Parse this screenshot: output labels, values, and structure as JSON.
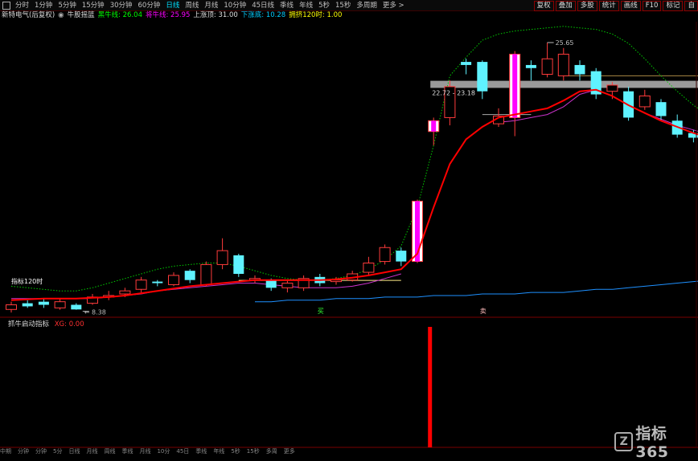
{
  "toolbar": {
    "periods": [
      "分时",
      "1分钟",
      "5分钟",
      "15分钟",
      "30分钟",
      "60分钟",
      "日线",
      "周线",
      "月线",
      "10分钟",
      "45日线",
      "季线",
      "年线",
      "5秒",
      "15秒",
      "多周期",
      "更多 >"
    ],
    "active": "日线",
    "right_buttons": [
      "复权",
      "叠加",
      "多股",
      "统计",
      "画线",
      "F10",
      "标记",
      "自"
    ]
  },
  "legend": {
    "stock": "新特电气(后复权)",
    "formula": "牛股摇篮",
    "items": [
      {
        "label": "黑牛线: 26.04",
        "color": "#00ff00"
      },
      {
        "label": "将牛线: 25.95",
        "color": "#ff00ff"
      },
      {
        "label": "上涨顶: 31.00",
        "color": "#dddddd"
      },
      {
        "label": "下涨底: 10.28",
        "color": "#00ccff"
      },
      {
        "label": "拥挤120时: 1.00",
        "color": "#ffff00"
      }
    ]
  },
  "annotations": {
    "high": "25.65",
    "low": "8.38",
    "band": "22.72 - 23.18",
    "left_label": "指标120时",
    "buy": "买",
    "sell": "卖"
  },
  "indicator": {
    "name": "抓牛启动指标",
    "value": "XG: 0.00"
  },
  "colors": {
    "up": "#ff3b3b",
    "down": "#5ff2ff",
    "ma": "#ff0000",
    "ma2": "#cc33cc",
    "upper": "#00cc00",
    "lower": "#1e90ff",
    "signal": "#ff0000"
  },
  "bottom": [
    "中期",
    "分钟",
    "分钟",
    "5分",
    "日线",
    "月线",
    "周线",
    "季线",
    "月线",
    "10分",
    "45日",
    "季线",
    "年线",
    "5秒",
    "15秒",
    "多周",
    "更多"
  ],
  "watermark": "指标365",
  "chart_data": {
    "type": "candlestick",
    "price_range": [
      8.0,
      27.0
    ],
    "candles": [
      [
        8.4,
        8.7,
        8.2,
        8.9
      ],
      [
        8.8,
        8.6,
        8.5,
        9.0
      ],
      [
        8.9,
        8.7,
        8.5,
        9.1
      ],
      [
        8.5,
        8.9,
        8.38,
        9.1
      ],
      [
        8.7,
        8.4,
        8.38,
        8.8
      ],
      [
        8.8,
        9.2,
        8.7,
        9.4
      ],
      [
        9.2,
        9.3,
        9.0,
        9.6
      ],
      [
        9.4,
        9.6,
        9.2,
        9.8
      ],
      [
        9.7,
        10.3,
        9.5,
        10.5
      ],
      [
        10.2,
        10.1,
        9.9,
        10.3
      ],
      [
        10.0,
        10.6,
        9.9,
        10.8
      ],
      [
        10.9,
        10.3,
        10.1,
        11.0
      ],
      [
        10.0,
        11.3,
        9.9,
        11.5
      ],
      [
        11.3,
        12.2,
        11.0,
        13.0
      ],
      [
        11.9,
        10.7,
        10.5,
        12.0
      ],
      [
        10.3,
        10.4,
        10.1,
        10.6
      ],
      [
        10.3,
        9.8,
        9.6,
        10.4
      ],
      [
        9.8,
        10.1,
        9.5,
        10.3
      ],
      [
        9.8,
        10.4,
        9.6,
        10.6
      ],
      [
        10.5,
        10.1,
        9.9,
        10.7
      ],
      [
        10.2,
        10.3,
        10.0,
        10.5
      ],
      [
        10.3,
        10.7,
        10.2,
        10.9
      ],
      [
        10.8,
        11.4,
        10.6,
        11.8
      ],
      [
        11.5,
        12.4,
        11.3,
        12.6
      ],
      [
        12.2,
        11.5,
        11.2,
        12.4
      ],
      [
        11.5,
        15.4,
        11.4,
        15.5
      ],
      [
        19.9,
        20.6,
        19.0,
        20.8
      ],
      [
        20.8,
        22.8,
        20.3,
        23.2
      ],
      [
        24.4,
        24.2,
        23.6,
        24.6
      ],
      [
        24.4,
        22.5,
        22.0,
        24.5
      ],
      [
        20.4,
        20.9,
        20.2,
        21.4
      ],
      [
        20.8,
        24.9,
        19.6,
        25.1
      ],
      [
        24.2,
        24.0,
        23.2,
        24.5
      ],
      [
        23.6,
        24.6,
        23.4,
        25.65
      ],
      [
        23.5,
        24.9,
        23.2,
        25.3
      ],
      [
        24.2,
        23.6,
        23.2,
        24.5
      ],
      [
        23.8,
        22.3,
        22.0,
        24.0
      ],
      [
        22.5,
        22.9,
        22.0,
        23.1
      ],
      [
        22.5,
        20.8,
        20.6,
        22.8
      ],
      [
        21.5,
        22.2,
        21.3,
        22.6
      ],
      [
        21.8,
        20.9,
        20.6,
        22.0
      ],
      [
        20.6,
        19.7,
        19.5,
        21.0
      ],
      [
        19.8,
        19.5,
        19.2,
        20.0
      ],
      [
        19.5,
        19.8,
        19.2,
        20.1
      ],
      [
        19.6,
        18.9,
        18.5,
        19.9
      ],
      [
        18.6,
        19.5,
        18.5,
        19.6
      ],
      [
        19.1,
        20.0,
        19.0,
        20.4
      ]
    ],
    "ma_line": [
      9.0,
      9.05,
      9.1,
      9.1,
      9.1,
      9.15,
      9.2,
      9.3,
      9.45,
      9.6,
      9.75,
      9.9,
      10.0,
      10.1,
      10.2,
      10.3,
      10.3,
      10.3,
      10.3,
      10.3,
      10.35,
      10.45,
      10.6,
      10.8,
      11.0,
      12.0,
      15.0,
      17.8,
      19.4,
      20.2,
      20.8,
      21.0,
      21.2,
      21.4,
      21.9,
      22.5,
      22.6,
      22.2,
      21.6,
      21.1,
      20.6,
      20.2,
      19.8,
      19.5,
      19.3,
      19.0,
      18.8
    ],
    "ma2_line": [
      9.1,
      9.1,
      9.1,
      9.1,
      9.1,
      9.1,
      9.2,
      9.3,
      9.4,
      9.6,
      9.7,
      9.8,
      9.9,
      10.0,
      10.1,
      10.1,
      10.0,
      9.9,
      9.8,
      9.8,
      9.8,
      9.9,
      10.1,
      10.4,
      10.7,
      null,
      null,
      null,
      null,
      null,
      20.5,
      20.6,
      20.8,
      21.0,
      21.5,
      22.3,
      22.6,
      22.2,
      21.6,
      21.1,
      20.7,
      20.3,
      20.0,
      19.7,
      19.4,
      19.1,
      18.9
    ],
    "upper_band": [
      9.9,
      9.8,
      9.7,
      9.6,
      9.6,
      9.8,
      10.1,
      10.4,
      10.7,
      11.0,
      11.2,
      11.3,
      11.4,
      11.4,
      11.2,
      10.9,
      10.6,
      10.4,
      10.3,
      10.3,
      10.4,
      10.6,
      11.0,
      11.6,
      12.5,
      15.0,
      19.0,
      23.5,
      24.7,
      25.8,
      26.2,
      26.4,
      26.5,
      26.6,
      26.7,
      26.6,
      26.5,
      26.2,
      25.6,
      24.6,
      23.5,
      22.5,
      21.6,
      20.9,
      20.4,
      20.2,
      20.3
    ],
    "lower_band": [
      null,
      null,
      null,
      null,
      null,
      null,
      null,
      null,
      null,
      null,
      null,
      null,
      null,
      null,
      null,
      8.9,
      8.9,
      9.0,
      9.0,
      9.0,
      9.1,
      9.1,
      9.1,
      9.2,
      9.2,
      9.2,
      9.3,
      9.3,
      9.3,
      9.4,
      9.4,
      9.4,
      9.5,
      9.5,
      9.5,
      9.6,
      9.7,
      9.7,
      9.8,
      9.9,
      10.0,
      10.1,
      10.2,
      10.3,
      10.4,
      10.5,
      10.6
    ],
    "highlight_candles": [
      25,
      26,
      31
    ],
    "band_levels": [
      22.72,
      23.18
    ],
    "mid_level": 10.28,
    "top_level": 23.5,
    "signal_bar_index": 26,
    "signal_value": 1.0
  }
}
